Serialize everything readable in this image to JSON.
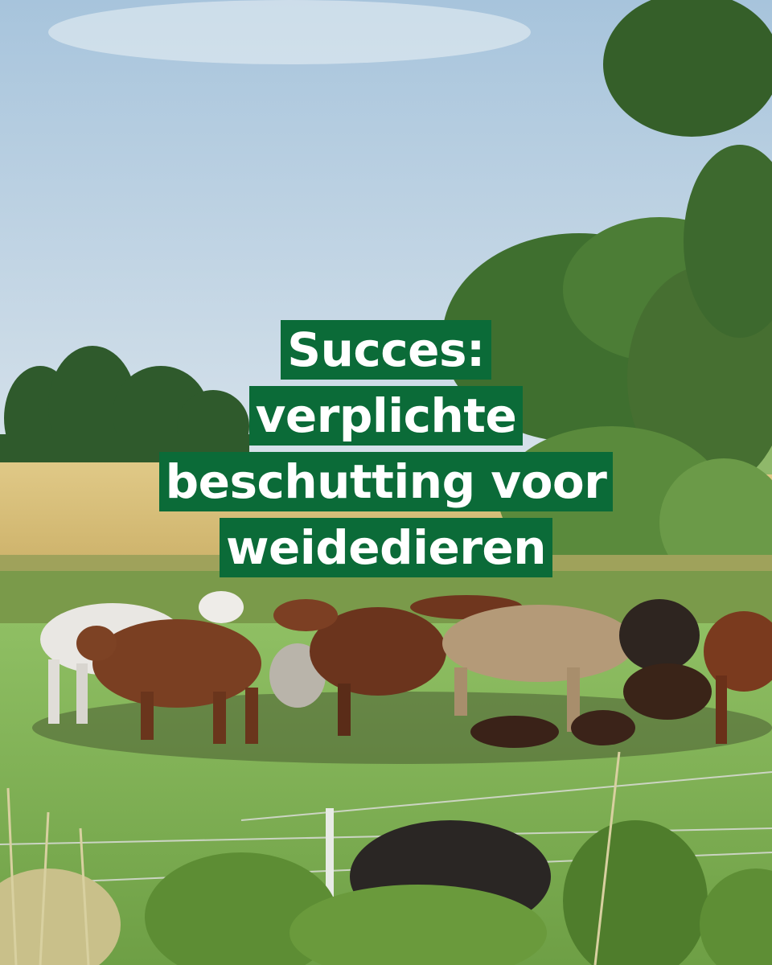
{
  "headline": {
    "lines": [
      "Succes:",
      "verplichte",
      "beschutting voor",
      "weidedieren"
    ]
  },
  "colors": {
    "label_background": "#0b6b38",
    "label_text": "#ffffff",
    "sky_top": "#a9c6de",
    "sky_bottom": "#d4e1ea",
    "wheat_field": "#d9c07e",
    "pasture": "#86b85a"
  }
}
